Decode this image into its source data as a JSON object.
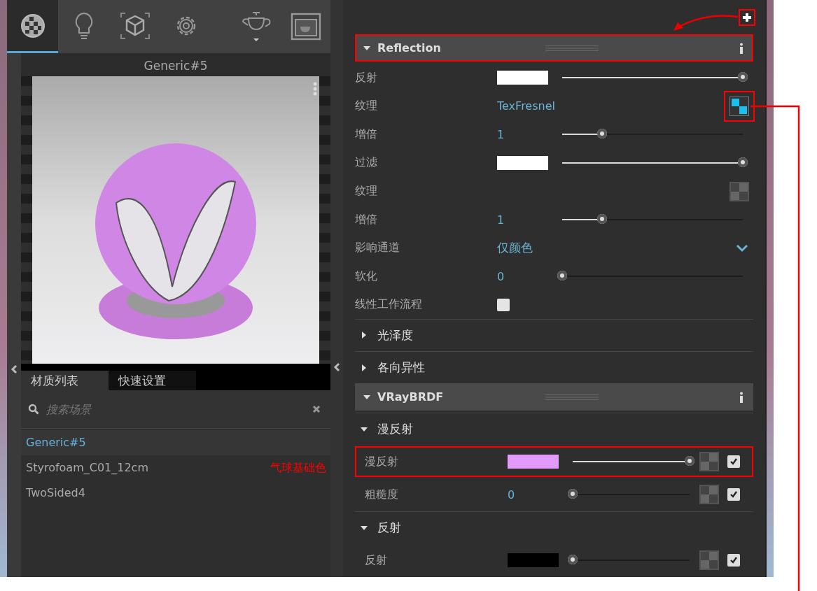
{
  "toolbar": {
    "tabs": [
      {
        "kind": "material",
        "selected": true
      },
      {
        "kind": "light",
        "selected": false
      },
      {
        "kind": "geometry",
        "selected": false
      },
      {
        "kind": "settings",
        "selected": false
      }
    ]
  },
  "preview": {
    "title": "Generic#5"
  },
  "list_tabs": [
    {
      "label": "材质列表",
      "selected": true
    },
    {
      "label": "快速设置",
      "selected": false
    }
  ],
  "search": {
    "placeholder": "搜索场景"
  },
  "materials": [
    {
      "name": "Generic#5",
      "selected": true
    },
    {
      "name": "Styrofoam_C01_12cm",
      "selected": false
    },
    {
      "name": "TwoSided4",
      "selected": false
    }
  ],
  "annotation_note": "气球基础色",
  "add_button": {
    "highlighted": true
  },
  "panel": [
    {
      "kind": "header",
      "title": "Reflection",
      "expanded": true,
      "highlighted": true,
      "rows": [
        {
          "kind": "color_slider",
          "label": "反射",
          "color": "#ffffff",
          "level": 1
        },
        {
          "kind": "texture",
          "label": "纹理",
          "value": "TexFresnel",
          "map_active": true,
          "highlighted": true
        },
        {
          "kind": "number_slider",
          "label": "增倍",
          "value": "1",
          "level": 0.22
        },
        {
          "kind": "color_slider",
          "label": "过滤",
          "color": "#ffffff",
          "level": 1
        },
        {
          "kind": "texture",
          "label": "纹理",
          "map_active": false,
          "highlighted": false
        },
        {
          "kind": "number_slider",
          "label": "增倍",
          "value": "1",
          "level": 0.22
        },
        {
          "kind": "dropdown",
          "label": "影响通道",
          "value": "仅颜色"
        },
        {
          "kind": "number_slider",
          "label": "软化",
          "value": "0",
          "level": 0
        },
        {
          "kind": "checkbox",
          "label": "线性工作流程",
          "checked": false
        }
      ]
    },
    {
      "kind": "group",
      "title": "光泽度",
      "expanded": false
    },
    {
      "kind": "group",
      "title": "各向异性",
      "expanded": false
    },
    {
      "kind": "header",
      "title": "VRayBRDF",
      "expanded": true,
      "highlighted": false,
      "children": [
        {
          "kind": "group",
          "title": "漫反射",
          "expanded": true,
          "rows": [
            {
              "kind": "color_slider",
              "label": "漫反射",
              "color": "#e29bfb",
              "level": 1,
              "map_active": false,
              "enabled": true,
              "highlighted": true
            },
            {
              "kind": "number_slider",
              "label": "粗糙度",
              "value": "0",
              "level": 0,
              "map_active": false,
              "enabled": true,
              "highlighted": false
            }
          ]
        },
        {
          "kind": "group",
          "title": "反射",
          "expanded": true,
          "rows": [
            {
              "kind": "color_slider",
              "label": "反射",
              "color": "#000000",
              "level": 0,
              "map_active": false,
              "enabled": true,
              "highlighted": false
            }
          ]
        }
      ]
    }
  ]
}
